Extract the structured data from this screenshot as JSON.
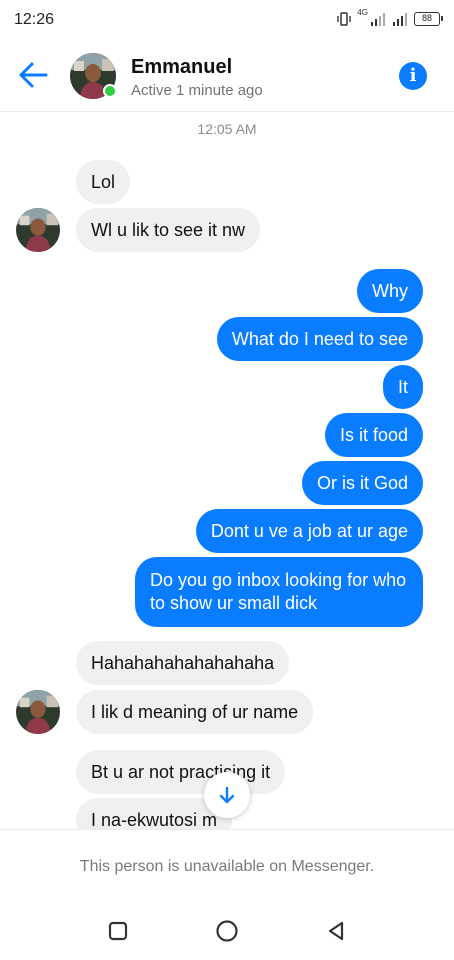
{
  "status_bar": {
    "time": "12:26",
    "network": "4G",
    "battery": "88"
  },
  "header": {
    "name": "Emmanuel",
    "status": "Active 1 minute ago",
    "info_icon": "i",
    "icons": [
      "back-arrow-icon",
      "info-icon"
    ]
  },
  "conversation": {
    "timestamp": "12:05 AM",
    "messages": [
      {
        "from": "contact",
        "text": "Lol"
      },
      {
        "from": "contact",
        "text": "Wl u lik to see it nw"
      },
      {
        "from": "me",
        "text": "Why"
      },
      {
        "from": "me",
        "text": "What do I need to see"
      },
      {
        "from": "me",
        "text": "It"
      },
      {
        "from": "me",
        "text": "Is it food"
      },
      {
        "from": "me",
        "text": "Or is it God"
      },
      {
        "from": "me",
        "text": "Dont u ve a job at ur age"
      },
      {
        "from": "me",
        "text": "Do you go inbox looking for who to show ur small dick"
      },
      {
        "from": "contact",
        "text": "Hahahahahahahahaha"
      },
      {
        "from": "contact",
        "text": "I lik d meaning of ur name"
      },
      {
        "from": "contact",
        "text": "Bt u ar not practising it"
      },
      {
        "from": "contact",
        "text": "I na-ekwutosi m"
      }
    ]
  },
  "footer": {
    "notice": "This person is unavailable on Messenger."
  },
  "nav": {
    "icons": [
      "recents-square-icon",
      "home-circle-icon",
      "back-triangle-icon"
    ]
  },
  "colors": {
    "accent": "#0a7cff",
    "incoming_bubble": "#f0f0f0",
    "online": "#31cc46"
  }
}
